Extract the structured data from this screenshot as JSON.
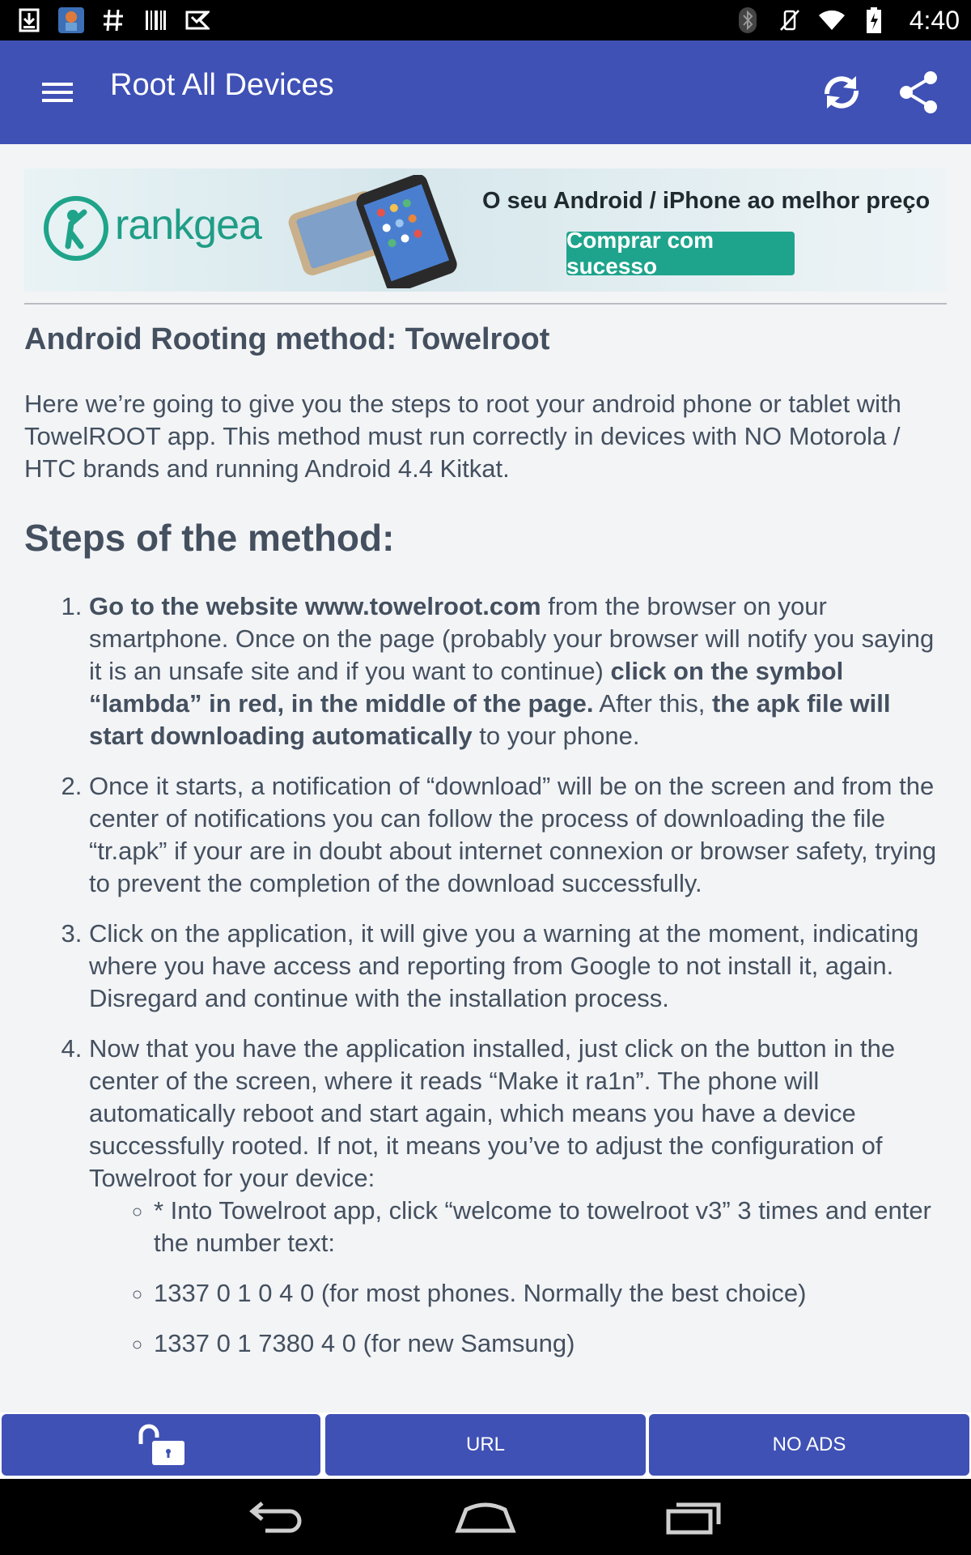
{
  "status_bar": {
    "time": "4:40",
    "left_icons": [
      "download-icon",
      "app-notification-icon",
      "hashtag-icon",
      "barcode-icon",
      "play-store-icon"
    ],
    "right_icons": [
      "bluetooth-icon",
      "vibrate-icon",
      "wifi-icon",
      "battery-icon"
    ]
  },
  "toolbar": {
    "title": "Root All Devices",
    "color": "#3f51b5"
  },
  "ad": {
    "brand": "rankgea",
    "headline": "O seu Android / iPhone ao melhor preço",
    "cta": "Comprar com sucesso",
    "cta_color": "#1ea48c"
  },
  "article": {
    "title": "Android Rooting method: Towelroot",
    "intro": "Here we’re going to give you the steps to root your android phone or tablet with TowelROOT app. This method must run correctly in devices with NO Motorola / HTC brands and running Android 4.4 Kitkat.",
    "steps_heading": "Steps of the method:",
    "step1": {
      "b1": "Go to the website www.towelroot.com",
      "t1": " from the browser on your smartphone. Once on the page (probably your browser will notify you saying it is an unsafe site and if you want to continue) ",
      "b2": "click on the symbol “lambda” in red, in the middle of the page.",
      "t2": " After this, ",
      "b3": "the apk file will start downloading automatically",
      "t3": " to your phone."
    },
    "step2": "Once it starts, a notification of “download” will be on the screen and from the center of notifications you can follow the process of downloading the file “tr.apk” if your are in doubt about internet connexion or browser safety, trying to prevent the completion of the download successfully.",
    "step3": "Click on the application, it will give you a warning at the moment, indicating where you have access and reporting from Google to not install it, again. Disregard and continue with the installation process.",
    "step4": "Now that you have the application installed, just click on the button in the center of the screen, where it reads “Make it ra1n”. The phone will automatically reboot and start again, which means you have a device successfully rooted. If not, it means you’ve to adjust the configuration of Towelroot for your device:",
    "sub_items": [
      "* Into Towelroot app, click “welcome to towelroot v3” 3 times and enter the number text:",
      "1337 0 1 0 4 0 (for most phones. Normally the best choice)",
      "1337 0 1 7380 4 0 (for new Samsung)"
    ]
  },
  "bottom_buttons": {
    "unlock_icon": "unlock-icon",
    "url_label": "URL",
    "no_ads_label": "NO ADS"
  },
  "nav_bar": {
    "icons": [
      "back-icon",
      "home-icon",
      "recents-icon"
    ]
  }
}
